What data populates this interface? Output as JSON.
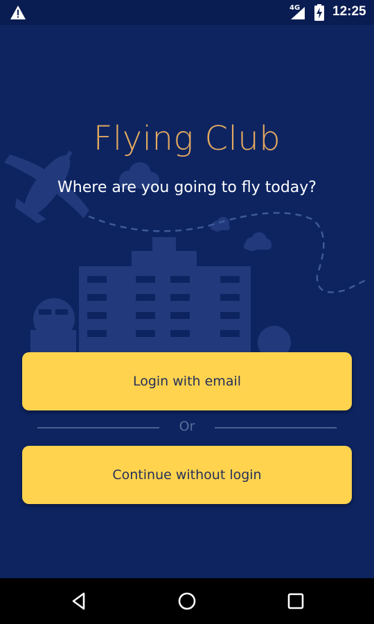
{
  "status_bar": {
    "network": "4G",
    "time": "12:25",
    "icons": [
      "warning-icon",
      "cellular-signal-icon",
      "battery-charging-icon"
    ]
  },
  "app": {
    "title": "Flying Club",
    "tagline": "Where are you going to fly today?"
  },
  "actions": {
    "login_label": "Login with email",
    "divider_label": "Or",
    "continue_label": "Continue without login"
  },
  "navigation": {
    "icons": [
      "back-icon",
      "home-icon",
      "recents-icon"
    ]
  },
  "colors": {
    "background": "#0d2461",
    "title": "#e3a960",
    "button": "#ffd34e",
    "button_text": "#24305a"
  }
}
